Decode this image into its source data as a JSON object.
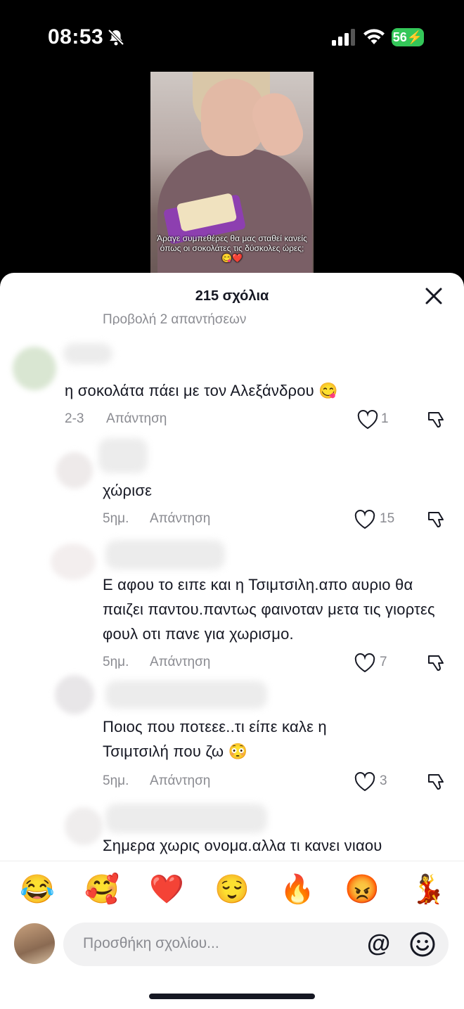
{
  "status_bar": {
    "time": "08:53",
    "battery": "56"
  },
  "video": {
    "caption": "Άραγε συμπεθέρες θα μας σταθεί κανείς όπως οι σοκολάτες τις δύσκολες ώρες; 😋❤️"
  },
  "sheet": {
    "title": "215 σχόλια",
    "replies_hint": "Προβολή 2 απαντήσεων"
  },
  "comments": [
    {
      "text": "η σοκολάτα πάει με τον Αλεξάνδρου 😋",
      "date": "2-3",
      "reply": "Απάντηση",
      "likes": "1"
    },
    {
      "text": "χώρισε",
      "date": "5ημ.",
      "reply": "Απάντηση",
      "likes": "15"
    },
    {
      "text": "Ε αφου το ειπε και η Τσιμτσιλη.απο αυριο θα παιζει παντου.παντως φαινοταν μετα τις γιορτες φουλ οτι πανε για χωρισμο.",
      "date": "5ημ.",
      "reply": "Απάντηση",
      "likes": "7"
    },
    {
      "text": "Ποιος που ποτεεε..τι είπε καλε η Τσιμτσιλή που ζω 😳",
      "date": "5ημ.",
      "reply": "Απάντηση",
      "likes": "3"
    },
    {
      "text": "Σημερα χωρις ονομα.αλλα τι κανει νιαου"
    }
  ],
  "emojis": [
    "😂",
    "🥰",
    "❤️",
    "😌",
    "🔥",
    "😡",
    "💃"
  ],
  "composer": {
    "placeholder": "Προσθήκη σχολίου...",
    "at": "@"
  }
}
